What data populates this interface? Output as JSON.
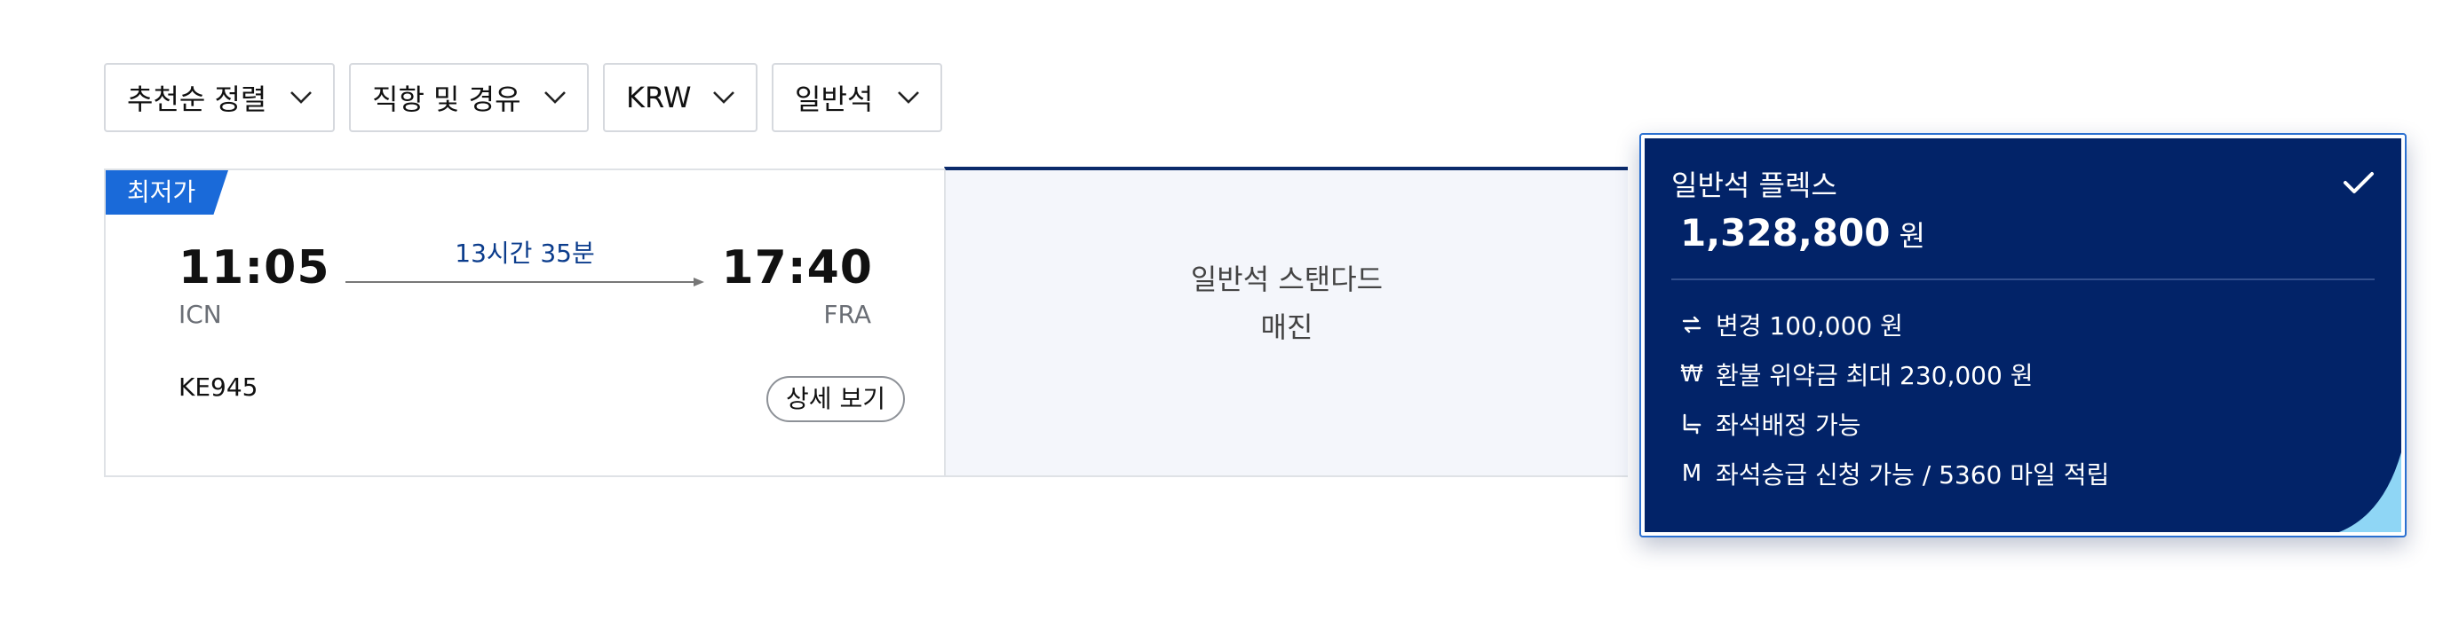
{
  "filters": [
    {
      "label": "추천순 정렬"
    },
    {
      "label": "직항 및 경유"
    },
    {
      "label": "KRW"
    },
    {
      "label": "일반석"
    }
  ],
  "flight": {
    "badge": "최저가",
    "departure_time": "11:05",
    "departure_airport": "ICN",
    "duration": "13시간 35분",
    "arrival_time": "17:40",
    "arrival_airport": "FRA",
    "flight_number": "KE945",
    "detail_button": "상세 보기"
  },
  "fares": {
    "standard": {
      "name": "일반석 스탠다드",
      "status": "매진"
    },
    "flex": {
      "name": "일반석 플렉스",
      "price": "1,328,800",
      "currency": "원",
      "selected": true,
      "benefits": [
        {
          "icon": "change-icon",
          "text": "변경 100,000 원"
        },
        {
          "icon": "won-icon",
          "text": "환불 위약금 최대 230,000 원"
        },
        {
          "icon": "seat-icon",
          "text": "좌석배정 가능"
        },
        {
          "icon": "mileage-icon",
          "text": "좌석승급 신청 가능 / 5360 마일 적립"
        }
      ]
    }
  },
  "colors": {
    "navy": "#022368",
    "badge_blue": "#1a6ad9",
    "duration_blue": "#0b3c8c",
    "selected_border": "#2a6fd0",
    "corner_accent": "#8fd6f5"
  }
}
